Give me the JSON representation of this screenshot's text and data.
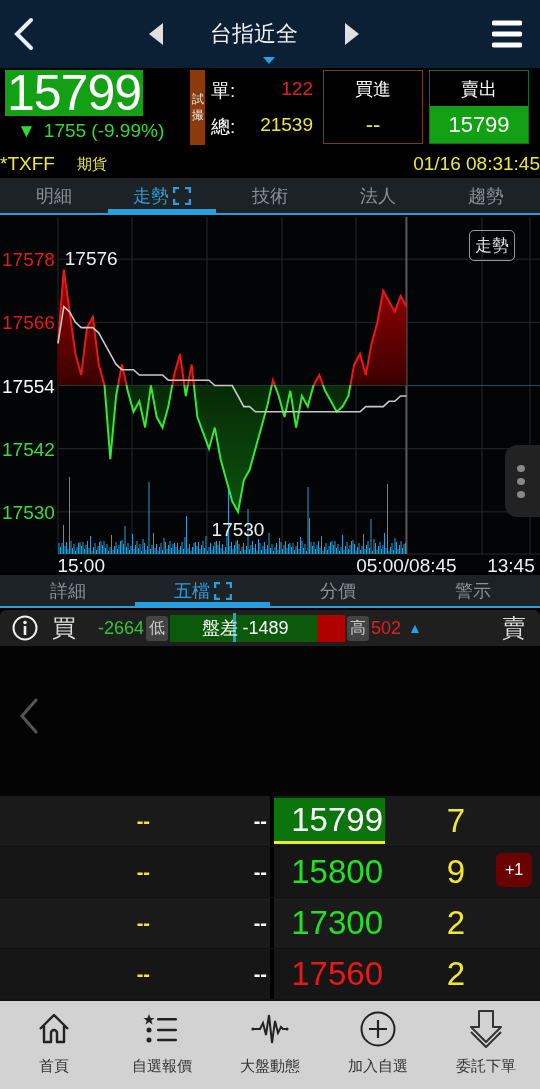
{
  "header": {
    "title": "台指近全"
  },
  "quote": {
    "price": "15799",
    "change_arrow": "▼",
    "change": "1755 (-9.99%)",
    "trial_tag": "試撮",
    "single_label": "單:",
    "single_value": "122",
    "total_label": "總:",
    "total_value": "21539",
    "buy": {
      "label": "買進",
      "value": "--"
    },
    "sell": {
      "label": "賣出",
      "value": "15799"
    },
    "symbol": "*TXFF",
    "type": "期貨",
    "time": "01/16 08:31:45"
  },
  "tabs": [
    {
      "label": "明細",
      "selected": false
    },
    {
      "label": "走勢",
      "selected": true
    },
    {
      "label": "技術",
      "selected": false
    },
    {
      "label": "法人",
      "selected": false
    },
    {
      "label": "趨勢",
      "selected": false
    }
  ],
  "chart": {
    "badge": "走勢",
    "chart_data": {
      "type": "area",
      "categories": [
        null,
        null,
        null,
        null,
        "15:00",
        null,
        null,
        null,
        null,
        null,
        null,
        null,
        null,
        null,
        null,
        null,
        null,
        null,
        null,
        null,
        null,
        null,
        null,
        null,
        null,
        null,
        null,
        null,
        null,
        null,
        null,
        null,
        null,
        null,
        null,
        null,
        null,
        null,
        null,
        null,
        null,
        null,
        null,
        null,
        null,
        null,
        null,
        null,
        null,
        null,
        null,
        null,
        null,
        null,
        null,
        null,
        null,
        null,
        null,
        null,
        "05:00/08:45",
        null,
        null,
        null,
        null,
        null,
        null,
        null,
        null,
        null,
        null,
        null,
        null,
        null,
        null,
        null,
        null,
        null,
        "13:45",
        null,
        null,
        null,
        null,
        null
      ],
      "grid": true,
      "ylim": [
        17522,
        17586
      ],
      "yticks": [
        17578,
        17566,
        17554,
        17542,
        17530
      ],
      "series": [
        {
          "type": "area",
          "color": "#e81818",
          "values": [
            17562,
            17576,
            17568,
            17560,
            17556,
            17565,
            17567,
            17558,
            17554,
            17540,
            17552,
            17558,
            17553,
            17549,
            17551,
            17546,
            17554,
            17548,
            17546,
            17550,
            17556,
            17560,
            17552,
            17558,
            17548,
            17545,
            17542,
            17546,
            17540,
            17536,
            17532,
            17530,
            17536,
            17538,
            17542,
            17546,
            17550,
            17555,
            17552,
            17548,
            17553,
            17546,
            17552,
            17550,
            17554,
            17556,
            17553,
            17551,
            17549,
            17550,
            17552,
            17558,
            17560,
            17556,
            17562,
            17566,
            17572,
            17570,
            17568,
            17571,
            17569,
            null,
            null,
            null,
            null,
            null,
            null,
            null,
            null,
            null,
            null,
            null,
            null,
            null,
            null,
            null,
            null,
            null,
            null,
            null,
            null,
            null,
            null,
            null
          ]
        },
        {
          "type": "line",
          "color": "#c8c8c8",
          "values": [
            17562,
            17569,
            17568,
            17566,
            17565,
            17565,
            17565,
            17564,
            17562,
            17560,
            17558,
            17557,
            17557,
            17557,
            17556,
            17556,
            17556,
            17556,
            17556,
            17555,
            17555,
            17555,
            17555,
            17555,
            17555,
            17555,
            17555,
            17554,
            17554,
            17554,
            17554,
            17552,
            17550,
            17550,
            17549,
            17549,
            17549,
            17549,
            17549,
            17549,
            17549,
            17549,
            17549,
            17549,
            17549,
            17549,
            17549,
            17549,
            17549,
            17549,
            17549,
            17549,
            17549,
            17550,
            17550,
            17550,
            17550,
            17551,
            17551,
            17552,
            17552,
            null,
            null,
            null,
            null,
            null,
            null,
            null,
            null,
            null,
            null,
            null,
            null,
            null,
            null,
            null,
            null,
            null,
            null,
            null,
            null,
            null,
            null,
            null
          ]
        }
      ],
      "ref_lines": [
        {
          "axis": "y",
          "value": 17554
        }
      ],
      "annotations": [
        "17576",
        "17530"
      ]
    }
  },
  "sub_tabs": [
    {
      "label": "詳細",
      "selected": false
    },
    {
      "label": "五檔",
      "selected": true
    },
    {
      "label": "分價",
      "selected": false
    },
    {
      "label": "警示",
      "selected": false
    }
  ],
  "spread": {
    "buy_label": "買",
    "low_value": "-2664",
    "low_label": "低",
    "bar_label": "盤差 -1489",
    "level": 0.84,
    "marker": {
      "level": 0.36
    },
    "high_label": "高",
    "high_value": "502",
    "high_arrow": "▲",
    "sell_label": "賣"
  },
  "order_book": {
    "rows": [
      {
        "bid_qty": "--",
        "bid_price": "--",
        "ask_price": "15799",
        "ask_qty": "7",
        "color": "#ffffff",
        "highlighted": true
      },
      {
        "bid_qty": "--",
        "bid_price": "--",
        "ask_price": "15800",
        "ask_qty": "9",
        "color": "#22e022",
        "highlighted": false,
        "badge": "+1"
      },
      {
        "bid_qty": "--",
        "bid_price": "--",
        "ask_price": "17300",
        "ask_qty": "2",
        "color": "#22e022",
        "highlighted": false
      },
      {
        "bid_qty": "--",
        "bid_price": "--",
        "ask_price": "17560",
        "ask_qty": "2",
        "color": "#e81818",
        "highlighted": false
      }
    ]
  },
  "nav": [
    {
      "label": "首頁",
      "kind": "home"
    },
    {
      "label": "自選報價",
      "kind": "list"
    },
    {
      "label": "大盤動態",
      "kind": "wave"
    },
    {
      "label": "加入自選",
      "kind": "add"
    },
    {
      "label": "委託下單",
      "kind": "order"
    }
  ]
}
